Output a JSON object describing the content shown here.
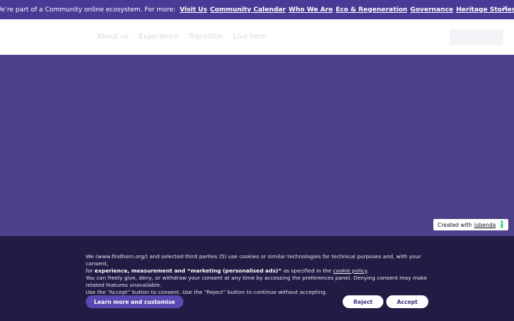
{
  "announcement": {
    "lead": "We’re part of a Community online ecosystem. For more:",
    "links": [
      "Visit Us",
      "Community Calendar",
      "Who We Are",
      "Eco & Regeneration",
      "Governance",
      "Heritage Stories"
    ],
    "end": ".",
    "close": "×"
  },
  "nav": {
    "items": [
      "About us",
      "Experience",
      "Transition",
      "Live here"
    ]
  },
  "iubenda": {
    "prefix": "Created with",
    "link": "iubenda"
  },
  "cookie": {
    "line1a": "We (www.findhorn.org/) and selected third parties (5) use cookies or similar technologies for technical purposes and, with your consent,",
    "line2a": "for",
    "line2b": "experience, measurement and “marketing (personalised ads)”",
    "line2c": "as specified in the",
    "line2d": "cookie policy",
    "line2e": ".",
    "line3": "You can freely give, deny, or withdraw your consent at any time by accessing the preferences panel. Denying consent may make related features unavailable.",
    "line4": "Use the “Accept” button to consent. Use the “Reject” button to continue without accepting.",
    "learn_more": "Learn more and customise",
    "reject": "Reject",
    "accept": "Accept"
  }
}
